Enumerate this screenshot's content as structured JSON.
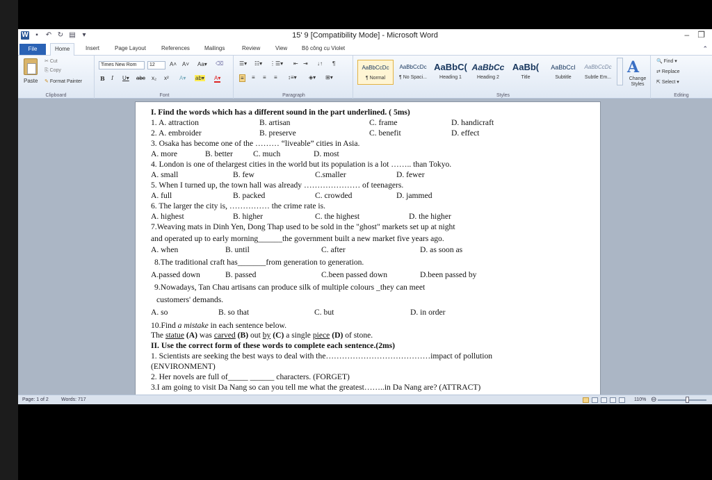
{
  "window": {
    "title": "15' 9 [Compatibility Mode] - Microsoft Word",
    "controls": [
      "–",
      "❐"
    ]
  },
  "tabs": [
    "File",
    "Home",
    "Insert",
    "Page Layout",
    "References",
    "Mailings",
    "Review",
    "View",
    "Bộ công cụ Violet"
  ],
  "ribbon": {
    "clipboard": {
      "paste": "Paste",
      "cut": "Cut",
      "copy": "Copy",
      "format_painter": "Format Painter",
      "label": "Clipboard"
    },
    "font": {
      "name": "Times New Rom",
      "size": "12",
      "label": "Font"
    },
    "paragraph": {
      "label": "Paragraph"
    },
    "styles": {
      "label": "Styles",
      "items": [
        {
          "sample": "AaBbCcDc",
          "name": "¶ Normal"
        },
        {
          "sample": "AaBbCcDc",
          "name": "¶ No Spaci..."
        },
        {
          "sample": "AaBbC(",
          "name": "Heading 1"
        },
        {
          "sample": "AaBbCc",
          "name": "Heading 2"
        },
        {
          "sample": "AaBb(",
          "name": "Title"
        },
        {
          "sample": "AaBbCcI",
          "name": "Subtitle"
        },
        {
          "sample": "AaBbCcDc",
          "name": "Subtle Em..."
        }
      ],
      "change_styles": "Change Styles"
    },
    "editing": {
      "find": "Find",
      "replace": "Replace",
      "select": "Select",
      "label": "Editing"
    }
  },
  "doc": {
    "l1": "I. Find the words which has a different sound in the part underlined. ( 5ms)",
    "q1": {
      "n": "1. A. ",
      "a": "attraction",
      "b": "B. artisan",
      "c": "C. frame",
      "d": "D. handicraft"
    },
    "q2": {
      "n": "2. A. ",
      "a": "embroider",
      "b": "B. preserve",
      "c": "C. benefit",
      "d": "D. effect"
    },
    "q3": "3. Osaka has become one of the ……… “liveable” cities in Asia.",
    "q3o": {
      "a": "A. more",
      "b": "B. better",
      "c": "C. much",
      "d": "D. most"
    },
    "q4": "4. London is one of thelargest cities in the world but its population is a lot …….. than Tokyo.",
    "q4o": {
      "a": "A. small",
      "b": "B. few",
      "c": "C.smaller",
      "d": "D. fewer"
    },
    "q5": "5. When I turned up, the town hall was already ………………… of teenagers.",
    "q5o": {
      "a": "A. full",
      "b": "B. packed",
      "c": "C. crowded",
      "d": "D. jammed"
    },
    "q6": "6. The larger the city is, …………… the crime rate is.",
    "q6o": {
      "a": "A. highest",
      "b": "B. higher",
      "c": "C. the highest",
      "d": "D. the higher"
    },
    "q7a": "7.Weaving mats in Dinh Yen, Dong Thap used to be sold in the \"ghost\" markets set up at night",
    "q7b": "and   operated up to early morning______the government built a new market five years ago.",
    "q7o": {
      "a": "A. when",
      "b": "B. until",
      "c": "C. after",
      "d": "D. as soon as"
    },
    "q8": "8.The traditional craft has_______from generation to generation.",
    "q8o": {
      "a": "A.passed down",
      "b": "B. passed",
      "c": "C.been passed down",
      "d": "D.been passed by"
    },
    "q9a": "9.Nowadays, Tan Chau artisans can produce silk of multiple colours _they can meet",
    "q9b": "customers' demands.",
    "q9o": {
      "a": "A. so",
      "b": "B. so that",
      "c": "C. but",
      "d": "D. in order"
    },
    "q10": {
      "pre": "10.Find ",
      "em": "a mistake",
      "post": " in each sentence below."
    },
    "q10s": {
      "w1": "The",
      "u1": "statue",
      "m1": " (A) ",
      "w2": "was ",
      "u2": "carved",
      "m2": " (B) ",
      "w3": "out ",
      "u3": "by",
      "m3": " (C) ",
      "w4": "a single ",
      "u4": "piece",
      "m4": " (D) ",
      "w5": "of stone."
    },
    "sec2": "II. Use the correct form of these words to complete each sentence.(2ms)",
    "s1a": "1. Scientists are seeking the best ways to deal with the…………………………………impact of pollution",
    "s1b": "(ENVIRONMENT)",
    "s2": "2. Her novels are full of_____ ______ characters. (FORGET)",
    "s3": "3.I am going to visit Da Nang   so can you tell me what  the greatest……..in Da Nang are? (ATTRACT)"
  },
  "status": {
    "page": "Page: 1 of 2",
    "words": "Words: 717",
    "zoom": "110%"
  }
}
